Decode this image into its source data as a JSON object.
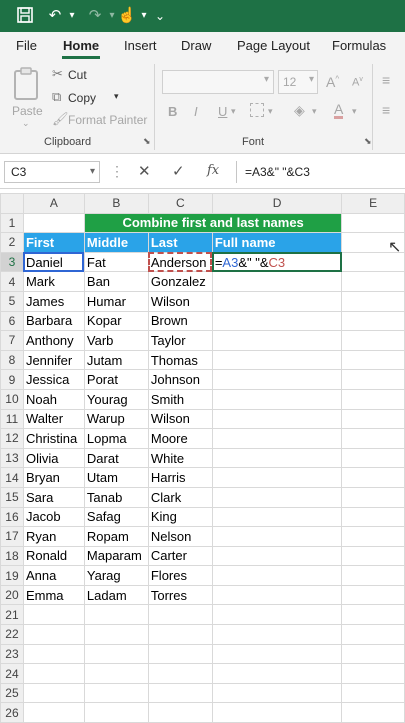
{
  "ribbon": {
    "tabs": [
      "File",
      "Home",
      "Insert",
      "Draw",
      "Page Layout",
      "Formulas"
    ],
    "active_tab": "Home",
    "paste_label": "Paste",
    "cut_label": "Cut",
    "copy_label": "Copy",
    "format_painter_label": "Format Painter",
    "clipboard_group": "Clipboard",
    "font_size": "12",
    "font_group": "Font"
  },
  "formula_bar": {
    "name_box": "C3",
    "fx_label": "fx",
    "formula": "=A3&\" \"&C3"
  },
  "sheet": {
    "columns": [
      "A",
      "B",
      "C",
      "D",
      "E"
    ],
    "title": "Combine first and last names",
    "headers": [
      "First",
      "Middle",
      "Last",
      "Full name"
    ],
    "edit_cell": {
      "prefix": "=",
      "ref1": "A3",
      "middle": "&\" \"&",
      "ref2": "C3"
    },
    "rows": [
      [
        "Daniel",
        "Fat",
        "Anderson"
      ],
      [
        "Mark",
        "Ban",
        "Gonzalez"
      ],
      [
        "James",
        "Humar",
        "Wilson"
      ],
      [
        "Barbara",
        "Kopar",
        "Brown"
      ],
      [
        "Anthony",
        "Varb",
        "Taylor"
      ],
      [
        "Jennifer",
        "Jutam",
        "Thomas"
      ],
      [
        "Jessica",
        "Porat",
        "Johnson"
      ],
      [
        "Noah",
        "Yourag",
        "Smith"
      ],
      [
        "Walter",
        "Warup",
        "Wilson"
      ],
      [
        "Christina",
        "Lopma",
        "Moore"
      ],
      [
        "Olivia",
        "Darat",
        "White"
      ],
      [
        "Bryan",
        "Utam",
        "Harris"
      ],
      [
        "Sara",
        "Tanab",
        "Clark"
      ],
      [
        "Jacob",
        "Safag",
        "King"
      ],
      [
        "Ryan",
        "Ropam",
        "Nelson"
      ],
      [
        "Ronald",
        "Maparam",
        "Carter"
      ],
      [
        "Anna",
        "Yarag",
        "Flores"
      ],
      [
        "Emma",
        "Ladam",
        "Torres"
      ]
    ],
    "row_numbers": [
      "1",
      "2",
      "3",
      "4",
      "5",
      "6",
      "7",
      "8",
      "9",
      "10",
      "11",
      "12",
      "13",
      "14",
      "15",
      "16",
      "17",
      "18",
      "19",
      "20",
      "21",
      "22",
      "23",
      "24",
      "25",
      "26"
    ]
  }
}
